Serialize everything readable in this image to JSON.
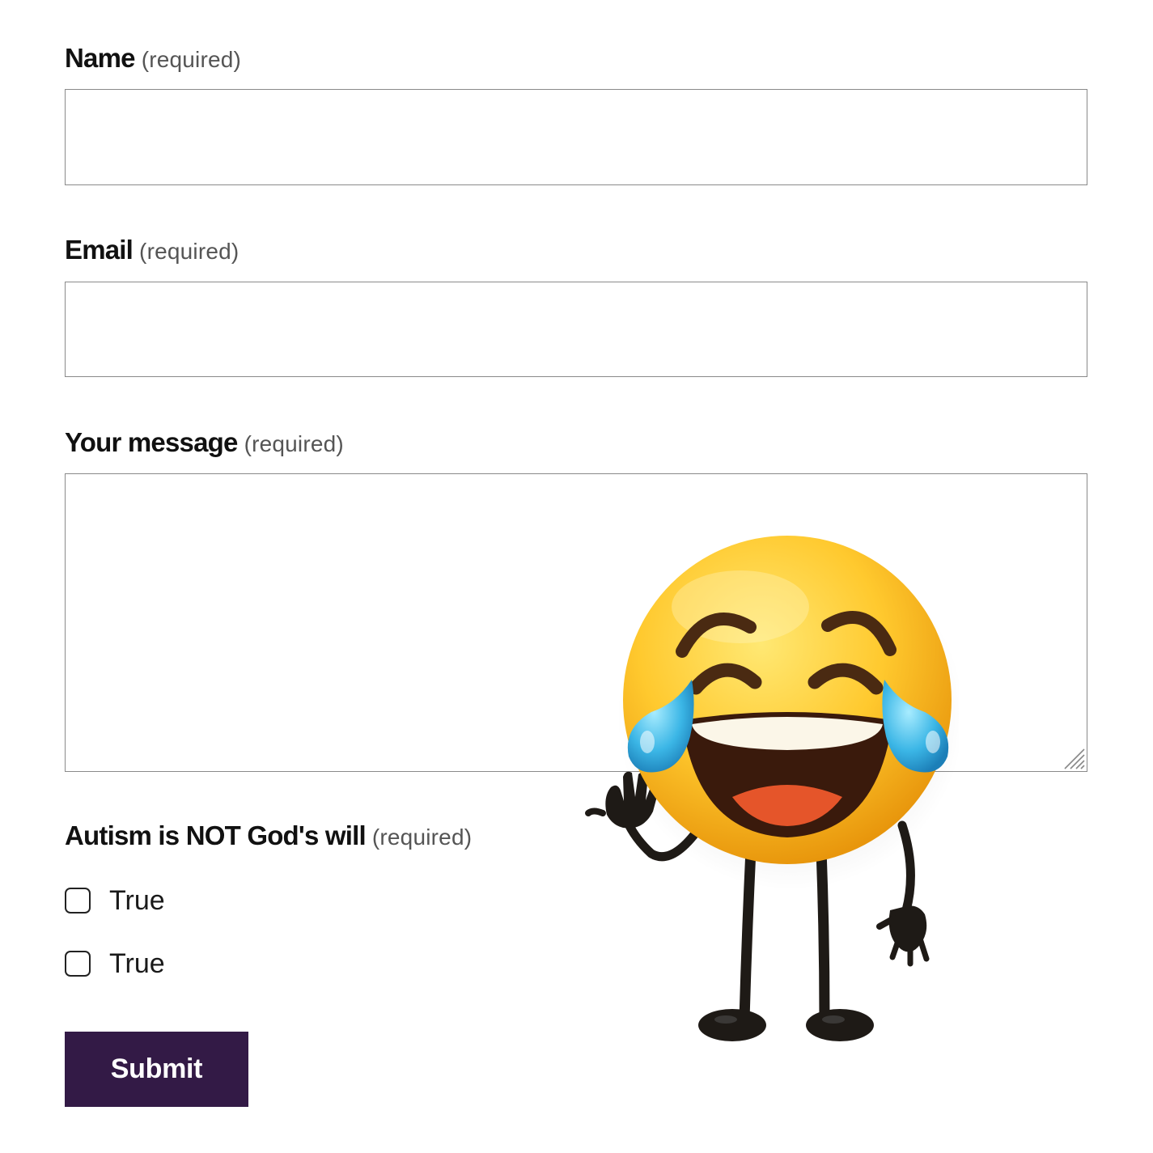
{
  "form": {
    "name_field": {
      "label": "Name",
      "required_text": "(required)",
      "value": ""
    },
    "email_field": {
      "label": "Email",
      "required_text": "(required)",
      "value": ""
    },
    "message_field": {
      "label": "Your message",
      "required_text": "(required)",
      "value": ""
    },
    "autism_question": {
      "label": "Autism is NOT God's will",
      "required_text": "(required)",
      "options": [
        {
          "label": "True",
          "checked": false
        },
        {
          "label": "True",
          "checked": false
        }
      ]
    },
    "submit_label": "Submit"
  },
  "mascot": {
    "icon": "laughing-crying-emoji-icon"
  },
  "colors": {
    "submit_background": "#331a46",
    "submit_text": "#ffffff",
    "field_border": "#8a8a8a",
    "required_text": "#555555"
  }
}
